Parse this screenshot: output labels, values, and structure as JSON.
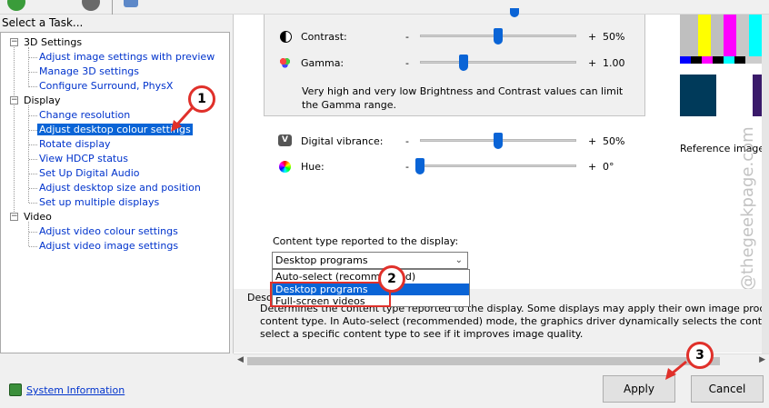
{
  "left_pane": {
    "header": "Select a Task...",
    "categories": [
      {
        "label": "3D Settings",
        "items": [
          "Adjust image settings with preview",
          "Manage 3D settings",
          "Configure Surround, PhysX"
        ]
      },
      {
        "label": "Display",
        "items": [
          "Change resolution",
          "Adjust desktop colour settings",
          "Rotate display",
          "View HDCP status",
          "Set Up Digital Audio",
          "Adjust desktop size and position",
          "Set up multiple displays"
        ]
      },
      {
        "label": "Video",
        "items": [
          "Adjust video colour settings",
          "Adjust video image settings"
        ]
      }
    ]
  },
  "settings": {
    "contrast": {
      "label": "Contrast:",
      "minus": "-",
      "plus": "+",
      "value_text": "50%",
      "value": 50
    },
    "gamma": {
      "label": "Gamma:",
      "minus": "-",
      "plus": "+",
      "value_text": "1.00",
      "value": 1.0
    },
    "note": "Very high and very low Brightness and Contrast values can limit the Gamma range.",
    "digital_vibrance": {
      "label": "Digital vibrance:",
      "minus": "-",
      "plus": "+",
      "value_text": "50%",
      "value": 50
    },
    "hue": {
      "label": "Hue:",
      "minus": "-",
      "plus": "+",
      "value_text": "0°",
      "value": 0
    }
  },
  "reference": {
    "label": "Reference image"
  },
  "content_type": {
    "label": "Content type reported to the display:",
    "selected": "Desktop programs",
    "options": [
      "Auto-select (recommended)",
      "Desktop programs",
      "Full-screen videos"
    ]
  },
  "description": {
    "title": "Description:",
    "lines": [
      "Determines the content type reported to the display. Some displays may apply their own image processing and filters based on the",
      "content type. In Auto-select (recommended) mode, the graphics driver dynamically selects the content type based on the application.",
      "select a specific content type to see if it improves image quality."
    ]
  },
  "footer": {
    "system_information": "System Information",
    "apply": "Apply",
    "cancel": "Cancel"
  },
  "annotations": {
    "badge1": "1",
    "badge2": "2",
    "badge3": "3",
    "color": "#e0302a"
  },
  "watermark": "@thegeekpage.com"
}
